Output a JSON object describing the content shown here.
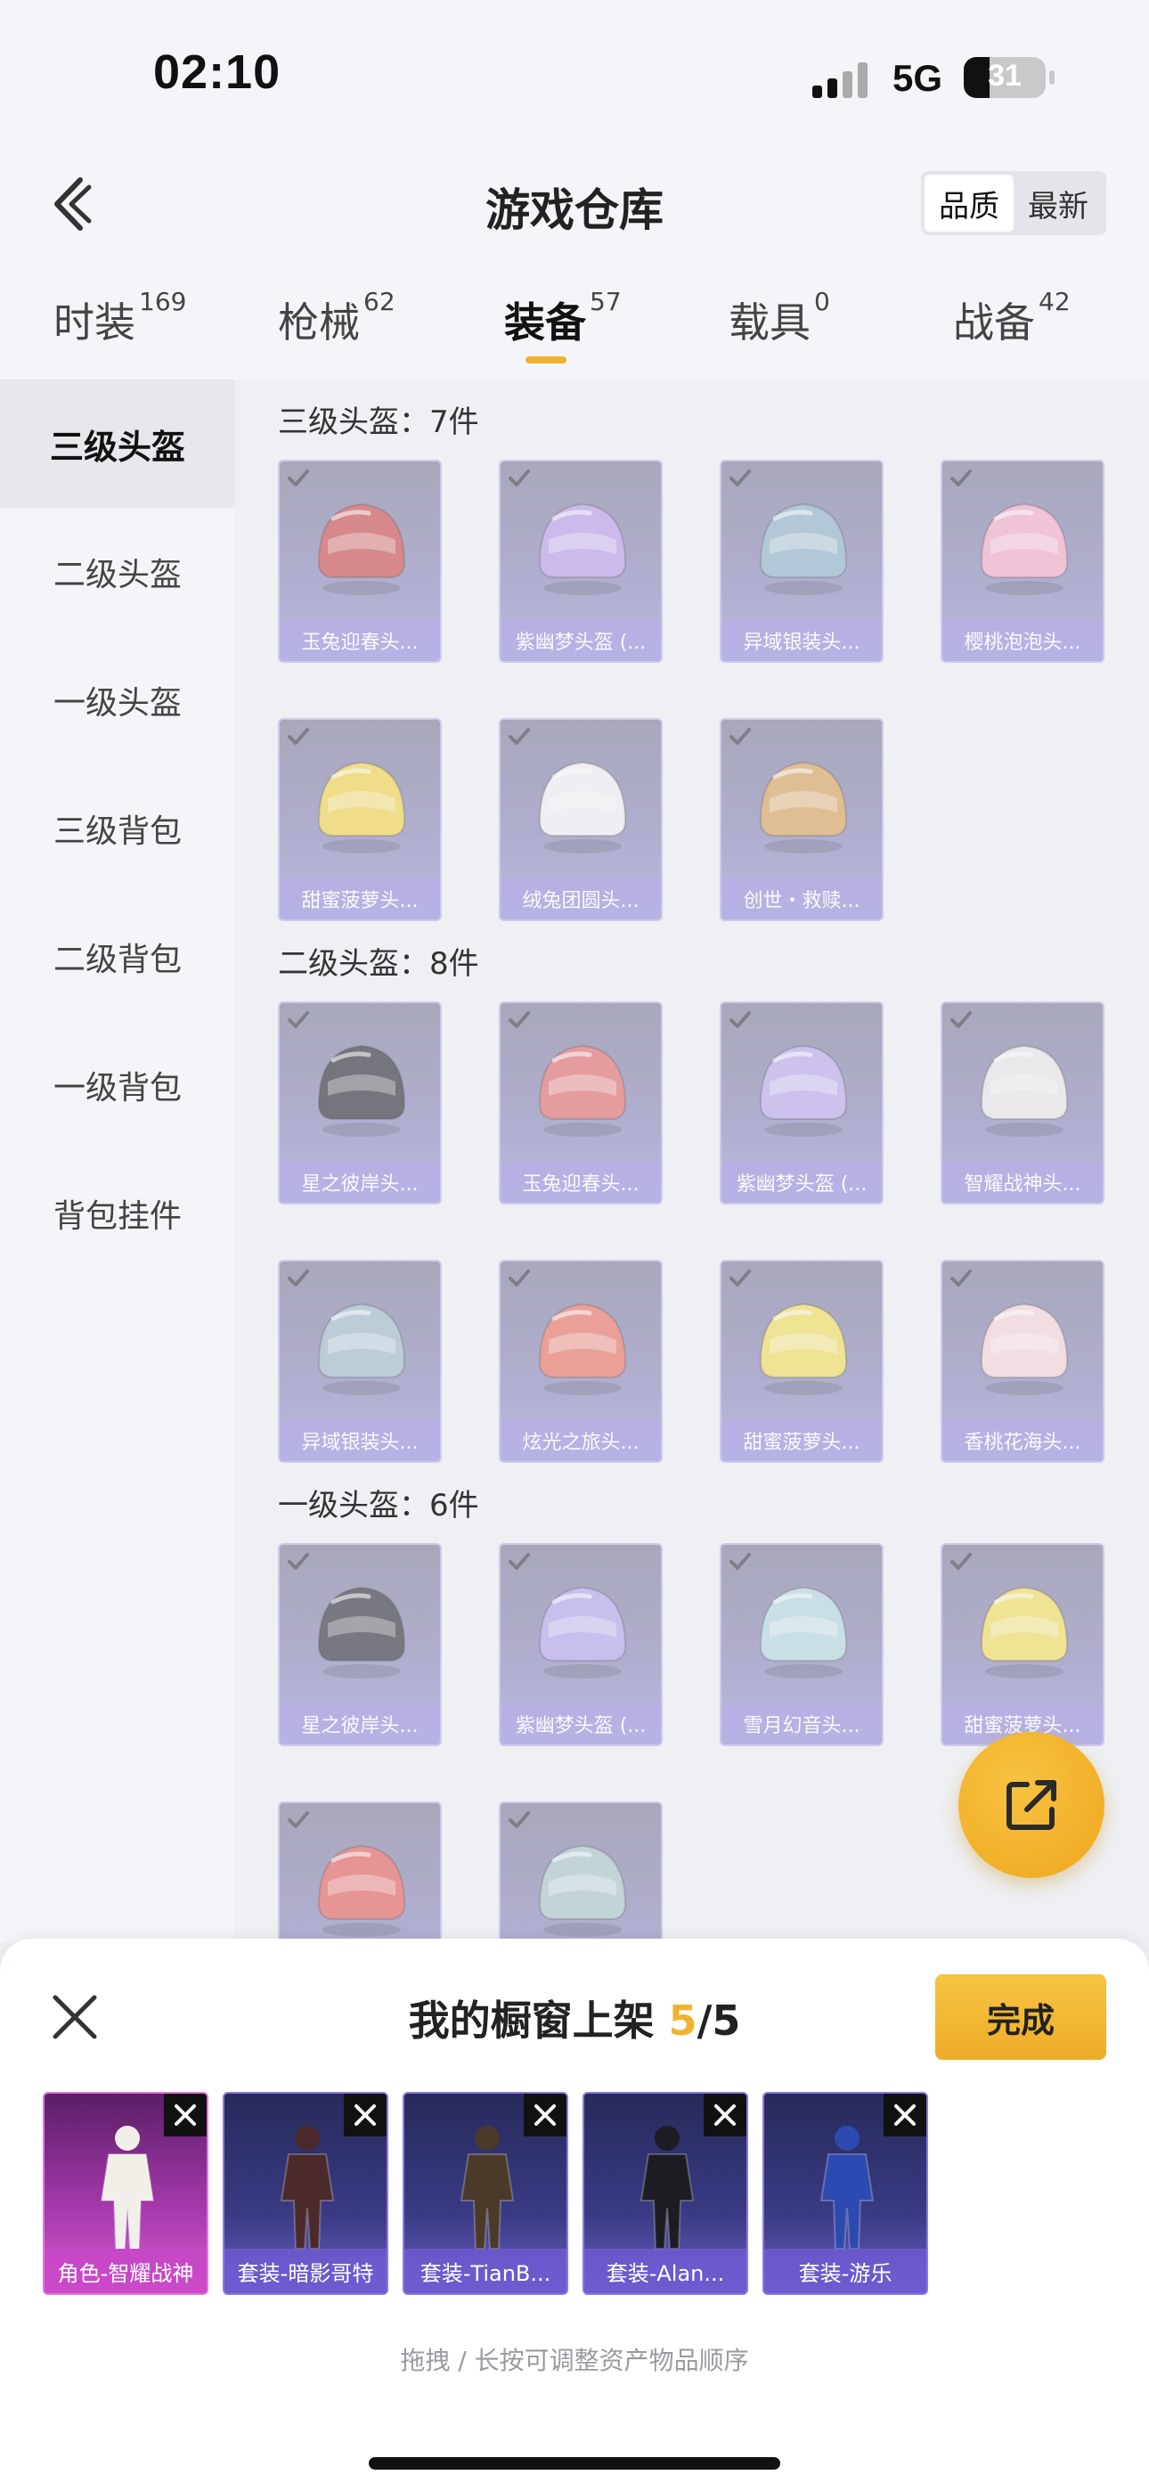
{
  "status_bar": {
    "time": "02:10",
    "network": "5G",
    "battery": "31",
    "battery_level": 0.31
  },
  "header": {
    "title": "游戏仓库",
    "sort_options": [
      "品质",
      "最新"
    ],
    "sort_active": 0
  },
  "tabs": [
    {
      "label": "时装",
      "count": "169"
    },
    {
      "label": "枪械",
      "count": "62"
    },
    {
      "label": "装备",
      "count": "57",
      "active": true
    },
    {
      "label": "载具",
      "count": "0"
    },
    {
      "label": "战备",
      "count": "42"
    }
  ],
  "sidebar": {
    "items": [
      "三级头盔",
      "二级头盔",
      "一级头盔",
      "三级背包",
      "二级背包",
      "一级背包",
      "背包挂件"
    ],
    "active": 0
  },
  "groups": [
    {
      "title": "三级头盔：7件",
      "items": [
        "玉兔迎春头...",
        "紫幽梦头盔 (...",
        "异域银装头...",
        "樱桃泡泡头...",
        "甜蜜菠萝头...",
        "绒兔团圆头...",
        "创世・救赎..."
      ]
    },
    {
      "title": "二级头盔：8件",
      "items": [
        "星之彼岸头...",
        "玉兔迎春头...",
        "紫幽梦头盔 (...",
        "智耀战神头...",
        "异域银装头...",
        "炫光之旅头...",
        "甜蜜菠萝头...",
        "香桃花海头..."
      ]
    },
    {
      "title": "一级头盔：6件",
      "items": [
        "星之彼岸头...",
        "紫幽梦头盔 (...",
        "雪月幻音头...",
        "甜蜜菠萝头...",
        "",
        ""
      ]
    }
  ],
  "helmet_colors": [
    "#c94a4a",
    "#b79ae6",
    "#8fb0c4",
    "#f2a9c6",
    "#f0d24a",
    "#f2eef2",
    "#d9a05a",
    "#2a2a36",
    "#e06a6a",
    "#b8a6ea",
    "#e8e4e6",
    "#9eb8c8",
    "#e87060",
    "#f0dc5a",
    "#f4d4d8",
    "#30303a",
    "#b3a2ec",
    "#b4d6de",
    "#f2dc5a",
    "#e45c5c",
    "#a8c4c8"
  ],
  "sheet": {
    "title_prefix": "我的橱窗上架 ",
    "count_current": "5",
    "count_total": "/5",
    "done_label": "完成",
    "hint": "拖拽 / 长按可调整资产物品顺序",
    "showcase": [
      {
        "label": "角色-智耀战神",
        "style": "pink"
      },
      {
        "label": "套装-暗影哥特",
        "style": "blue"
      },
      {
        "label": "套装-TianB...",
        "style": "blue"
      },
      {
        "label": "套装-Alan...",
        "style": "blue"
      },
      {
        "label": "套装-游乐",
        "style": "blue"
      }
    ]
  }
}
